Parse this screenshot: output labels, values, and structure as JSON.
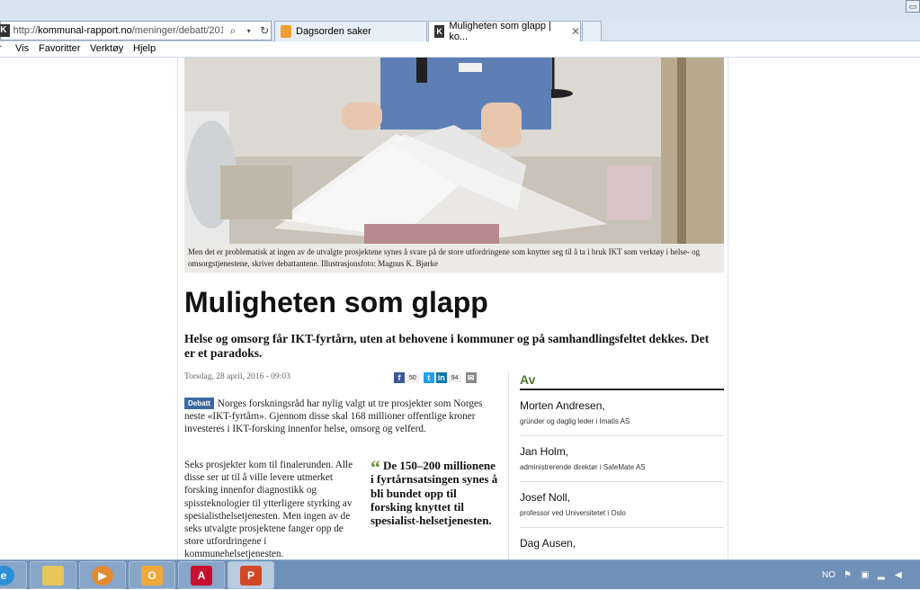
{
  "browser": {
    "url_prefix": "http://",
    "url_domain": "kommunal-rapport.no",
    "url_path": "/meninger/debatt/2016/(",
    "tabs": [
      {
        "label": "Dagsorden saker"
      },
      {
        "label": "Muligheten som glapp | ko..."
      }
    ],
    "menu": [
      "r",
      "Vis",
      "Favoritter",
      "Verktøy",
      "Hjelp"
    ]
  },
  "article": {
    "photo_caption": "Men det er problematisk at ingen av de utvalgte prosjektene synes å svare på de store utfordringene som knytter seg til å ta i bruk IKT som verktøy i helse- og omsorgstjenestene, skriver debattantene. Illustrasjonsfoto: Magnus K. Bjørke",
    "headline": "Muligheten som glapp",
    "lead": "Helse og omsorg får IKT-fyrtårn, uten at behovene i kommuner og på samhandlingsfeltet dekkes. Det er et paradoks.",
    "date": "Torsdag, 28 april, 2016 - 09:03",
    "share": {
      "facebook_count": "50",
      "linkedin_count": "94"
    },
    "tag": "Debatt",
    "para1": "Norges forskningsråd har nylig valgt ut tre prosjekter som Norges neste «IKT-fyrtårn». Gjennom disse skal 168 millioner offentlige kroner investeres i IKT-forsking innenfor helse, omsorg og velferd.",
    "para2": "Seks prosjekter kom til finalerunden. Alle disse ser ut til å ville levere utmerket forsking innenfor diagnostikk og spissteknologier til ytterligere styrking av spesialisthelsetjenesten. Men ingen av de seks utvalgte prosjektene fanger opp de store utfordringene i kommunehelsetjenesten.",
    "pull_quote": "De 150–200 millionene i fyrtårnsatsingen synes å bli bundet opp til forsking knyttet til spesialist-helsetjenesten."
  },
  "aside": {
    "title": "Av",
    "authors": [
      {
        "name": "Morten Andresen,",
        "role": "gründer og daglig leder i Imatis AS"
      },
      {
        "name": "Jan Holm,",
        "role": "administrerende direktør i SafeMate AS"
      },
      {
        "name": "Josef Noll,",
        "role": "professor ved Universitetet i Oslo"
      },
      {
        "name": "Dag Ausen,",
        "role": ""
      }
    ]
  },
  "taskbar": {
    "apps": [
      "internet-explorer-icon",
      "folder-icon",
      "media-player-icon",
      "outlook-icon",
      "acrobat-icon",
      "powerpoint-icon"
    ],
    "language": "NO"
  }
}
